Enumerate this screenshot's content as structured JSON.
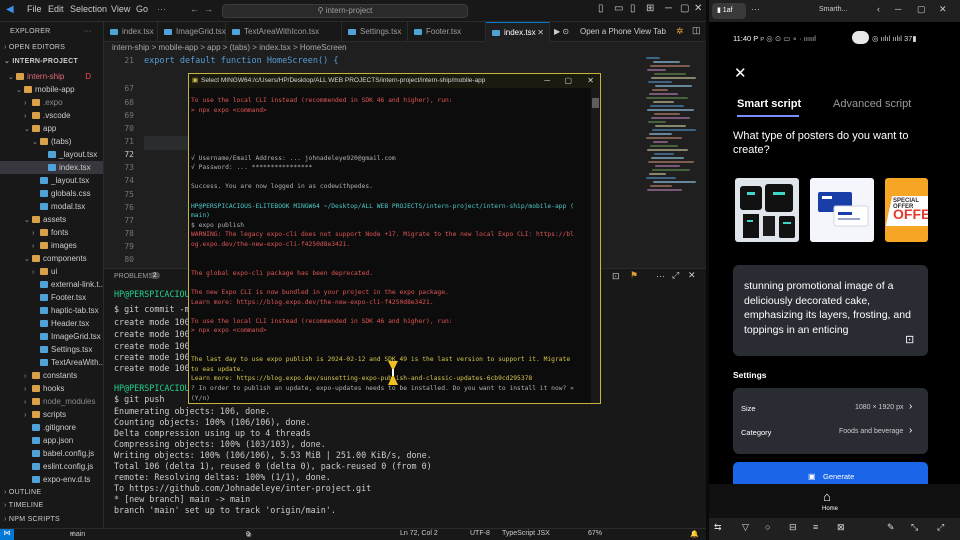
{
  "vscode": {
    "menu": [
      "File",
      "Edit",
      "Selection",
      "View",
      "Go"
    ],
    "search_placeholder": "intern-project",
    "explorer": {
      "title": "EXPLORER",
      "open_editors": "OPEN EDITORS",
      "project": "INTERN-PROJECT",
      "items": [
        {
          "label": "intern-ship",
          "indent": 1,
          "type": "folder-open",
          "color": "#e06c75",
          "badge": "D"
        },
        {
          "label": "mobile-app",
          "indent": 2,
          "type": "folder-open",
          "color": "#cccccc"
        },
        {
          "label": ".expo",
          "indent": 3,
          "type": "folder",
          "color": "#8b8b8b"
        },
        {
          "label": ".vscode",
          "indent": 3,
          "type": "folder",
          "color": "#cccccc"
        },
        {
          "label": "app",
          "indent": 3,
          "type": "folder-open",
          "color": "#cccccc"
        },
        {
          "label": "(tabs)",
          "indent": 4,
          "type": "folder-open",
          "color": "#cccccc"
        },
        {
          "label": "_layout.tsx",
          "indent": 5,
          "type": "file",
          "color": "#cccccc"
        },
        {
          "label": "index.tsx",
          "indent": 5,
          "type": "file",
          "color": "#cccccc",
          "selected": true
        },
        {
          "label": "_layout.tsx",
          "indent": 4,
          "type": "file",
          "color": "#cccccc"
        },
        {
          "label": "globals.css",
          "indent": 4,
          "type": "file",
          "color": "#cccccc"
        },
        {
          "label": "modal.tsx",
          "indent": 4,
          "type": "file",
          "color": "#cccccc"
        },
        {
          "label": "assets",
          "indent": 3,
          "type": "folder-open",
          "color": "#cccccc"
        },
        {
          "label": "fonts",
          "indent": 4,
          "type": "folder",
          "color": "#cccccc"
        },
        {
          "label": "images",
          "indent": 4,
          "type": "folder",
          "color": "#cccccc"
        },
        {
          "label": "components",
          "indent": 3,
          "type": "folder-open",
          "color": "#cccccc"
        },
        {
          "label": "ui",
          "indent": 4,
          "type": "folder",
          "color": "#cccccc"
        },
        {
          "label": "external-link.t...",
          "indent": 4,
          "type": "file",
          "color": "#cccccc"
        },
        {
          "label": "Footer.tsx",
          "indent": 4,
          "type": "file",
          "color": "#cccccc"
        },
        {
          "label": "haptic-tab.tsx",
          "indent": 4,
          "type": "file",
          "color": "#cccccc"
        },
        {
          "label": "Header.tsx",
          "indent": 4,
          "type": "file",
          "color": "#cccccc"
        },
        {
          "label": "ImageGrid.tsx",
          "indent": 4,
          "type": "file",
          "color": "#cccccc"
        },
        {
          "label": "Settings.tsx",
          "indent": 4,
          "type": "file",
          "color": "#cccccc"
        },
        {
          "label": "TextAreaWith...",
          "indent": 4,
          "type": "file",
          "color": "#cccccc"
        },
        {
          "label": "constants",
          "indent": 3,
          "type": "folder",
          "color": "#cccccc"
        },
        {
          "label": "hooks",
          "indent": 3,
          "type": "folder",
          "color": "#cccccc"
        },
        {
          "label": "node_modules",
          "indent": 3,
          "type": "folder",
          "color": "#8b8b8b"
        },
        {
          "label": "scripts",
          "indent": 3,
          "type": "folder",
          "color": "#cccccc"
        },
        {
          "label": ".gitignore",
          "indent": 3,
          "type": "file",
          "color": "#cccccc"
        },
        {
          "label": "app.json",
          "indent": 3,
          "type": "file",
          "color": "#cccccc"
        },
        {
          "label": "babel.config.js",
          "indent": 3,
          "type": "file",
          "color": "#cccccc"
        },
        {
          "label": "eslint.config.js",
          "indent": 3,
          "type": "file",
          "color": "#cccccc"
        },
        {
          "label": "expo-env.d.ts",
          "indent": 3,
          "type": "file",
          "color": "#cccccc"
        }
      ],
      "outline": "OUTLINE",
      "timeline": "TIMELINE",
      "npm_scripts": "NPM SCRIPTS"
    },
    "tabs": [
      "index.tsx",
      "ImageGrid.tsx",
      "TextAreaWithIcon.tsx",
      "Settings.tsx",
      "Footer.tsx",
      "index.tsx",
      "Open a Phone View Tab"
    ],
    "active_tab": 5,
    "breadcrumb": "intern-ship > mobile-app > app > (tabs) > index.tsx > HomeScreen",
    "line_numbers": [
      "21",
      "67",
      "68",
      "69",
      "70",
      "71",
      "72",
      "73",
      "74",
      "75",
      "76",
      "77",
      "78",
      "79",
      "80",
      "81",
      "82"
    ],
    "current_line": "72",
    "code_line": "export default function HomeScreen() {",
    "terminal": {
      "header_label": "PROBLEMS",
      "problems_count": "2",
      "prompt": "HP@PERSPICACIOU",
      "commit": "$ git commit -m",
      "create_lines": [
        "create mode 100",
        "create mode 100",
        "create mode 100",
        "create mode 100",
        "create mode 100"
      ],
      "push_cmd": "$ git push",
      "output": [
        "Enumerating objects: 106, done.",
        "Counting objects: 100% (106/106), done.",
        "Delta compression using up to 4 threads",
        "Compressing objects: 100% (103/103), done.",
        "Writing objects: 100% (106/106), 5.53 MiB | 251.00 KiB/s, done.",
        "Total 106 (delta 1), reused 0 (delta 0), pack-reused 0 (from 0)",
        "remote: Resolving deltas: 100% (1/1), done.",
        "To https://github.com/Johnadeleye/inter-project.git",
        " * [new branch]      main -> main",
        "branch 'main' set up to track 'origin/main'."
      ]
    },
    "status": {
      "branch": "main",
      "problems": "0",
      "cursor": "Ln 72, Col 2",
      "encoding": "UTF-8",
      "lang": "TypeScript JSX",
      "battery": "67%"
    }
  },
  "cmd": {
    "title": "Select MINGW64:/c/Users/HP/Desktop/ALL WEB PROJECTS/intern-project/intern-ship/mobile-app",
    "lines": [
      {
        "t": "   To use the local CLI instead (recommended in SDK 46 and higher), run:",
        "c": "red"
      },
      {
        "t": "   > npx expo <command>",
        "c": "red"
      },
      {
        "t": "",
        "c": "grey"
      },
      {
        "t": "",
        "c": "grey"
      },
      {
        "t": "",
        "c": "grey"
      },
      {
        "t": "",
        "c": "grey"
      },
      {
        "t": "√ Username/Email Address: ... johnadeleye920@gmail.com",
        "c": "grey"
      },
      {
        "t": "√ Password: ... ****************",
        "c": "grey"
      },
      {
        "t": "",
        "c": "grey"
      },
      {
        "t": "Success. You are now logged in as codewithpedes.",
        "c": "grey"
      },
      {
        "t": "",
        "c": "grey"
      },
      {
        "t": "HP@PERSPICACIOUS-ELITEBOOK MINGW64 ~/Desktop/ALL WEB PROJECTS/intern-project/intern-ship/mobile-app (",
        "c": "cyan"
      },
      {
        "t": "main)",
        "c": "cyan"
      },
      {
        "t": "$ expo publish",
        "c": "grey"
      },
      {
        "t": "WARNING: The legacy expo-cli does not support Node +17. Migrate to the new local Expo CLI: https://bl",
        "c": "red"
      },
      {
        "t": "og.expo.dev/the-new-expo-cli-f4250d8e3421.",
        "c": "red"
      },
      {
        "t": "",
        "c": "grey"
      },
      {
        "t": "",
        "c": "grey"
      },
      {
        "t": "   The global expo-cli package has been deprecated.",
        "c": "red"
      },
      {
        "t": "",
        "c": "grey"
      },
      {
        "t": "   The new Expo CLI is now bundled in your project in the expo package.",
        "c": "red"
      },
      {
        "t": "   Learn more: https://blog.expo.dev/the-new-expo-cli-f4250d8e3421.",
        "c": "red"
      },
      {
        "t": "",
        "c": "grey"
      },
      {
        "t": "   To use the local CLI instead (recommended in SDK 46 and higher), run:",
        "c": "red"
      },
      {
        "t": "   > npx expo <command>",
        "c": "red"
      },
      {
        "t": "",
        "c": "grey"
      },
      {
        "t": "",
        "c": "grey"
      },
      {
        "t": "The last day to use expo publish is 2024-02-12 and SDK 49 is the last version to support it. Migrate",
        "c": "dyel"
      },
      {
        "t": " to eas update.",
        "c": "dyel"
      },
      {
        "t": "Learn more: https://blog.expo.dev/sunsetting-expo-publish-and-classic-updates-6cb9cd295378",
        "c": "dyel"
      },
      {
        "t": "? In order to publish an update, expo-updates needs to be installed. Do you want to install it now? »",
        "c": "grey"
      },
      {
        "t": "  (Y/n)",
        "c": "grey"
      }
    ]
  },
  "phone": {
    "taskbar_tab": "1af",
    "browser_title": "Smarth...",
    "time": "11:40 P",
    "status_right": "37",
    "tab_smart": "Smart script",
    "tab_advanced": "Advanced script",
    "question": "What type of posters do you want to create?",
    "tiles": [
      {
        "name": "merch",
        "color": "#dfe5ea"
      },
      {
        "name": "business-card",
        "color": "#f4f6fb"
      },
      {
        "name": "special-offer",
        "color": "#f6a524",
        "text": "SPECIAL OFFER"
      }
    ],
    "prompt_text": "stunning promotional image of a deliciously decorated cake, emphasizing its layers, frosting, and toppings in an enticing",
    "settings_title": "Settings",
    "size_label": "Size",
    "size_value": "1080 × 1920 px",
    "category_label": "Category",
    "category_value": "Foods and beverage",
    "generate_label": "Generate",
    "home_label": "Home"
  }
}
